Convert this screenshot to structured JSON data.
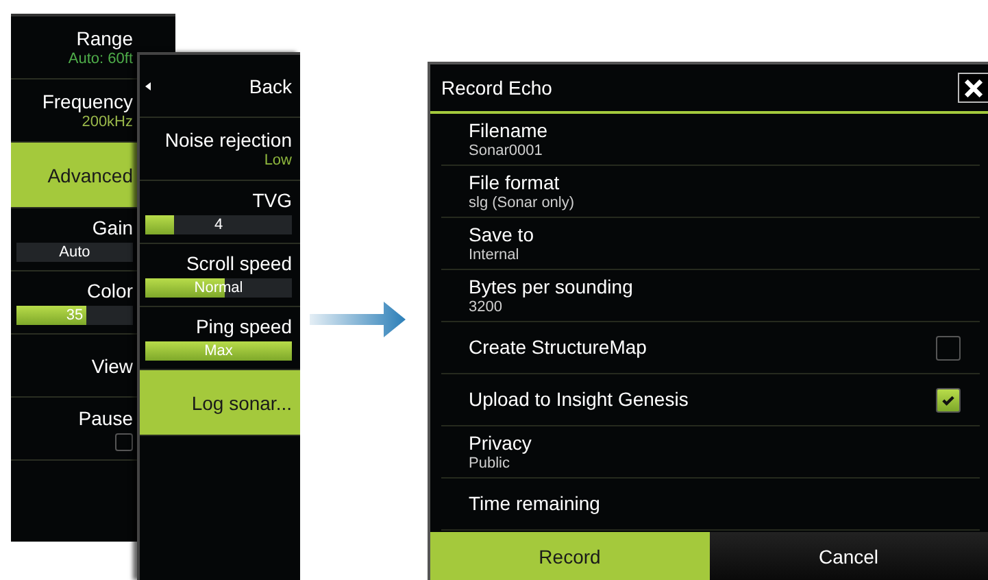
{
  "back_menu": {
    "items": [
      {
        "kind": "value",
        "label": "Range",
        "value": "Auto: 60ft",
        "color": "#4fae4a"
      },
      {
        "kind": "value",
        "label": "Frequency",
        "value": "200kHz",
        "color": "#9ab84a"
      },
      {
        "kind": "button",
        "label": "Advanced",
        "selected": true
      },
      {
        "kind": "slider",
        "label": "Gain",
        "reading": "Auto"
      },
      {
        "kind": "slider",
        "label": "Color",
        "reading": "35",
        "level": 0.6
      },
      {
        "kind": "button",
        "label": "View",
        "selected": false
      },
      {
        "kind": "checkbox",
        "label": "Pause",
        "checked": false
      }
    ]
  },
  "front_menu": {
    "items": [
      {
        "kind": "back",
        "label": "Back"
      },
      {
        "kind": "value",
        "label": "Noise rejection",
        "value": "Low",
        "color": "#8fb83e"
      },
      {
        "kind": "slider",
        "label": "TVG",
        "reading": "4",
        "level": 0.2
      },
      {
        "kind": "slider",
        "label": "Scroll speed",
        "reading": "Normal",
        "level": 0.54
      },
      {
        "kind": "slider",
        "label": "Ping speed",
        "reading": "Max",
        "level": 1
      },
      {
        "kind": "button",
        "label": "Log sonar...",
        "selected": true
      }
    ]
  },
  "dialog": {
    "title": "Record Echo",
    "rows": [
      {
        "kind": "value",
        "label": "Filename",
        "value": "Sonar0001"
      },
      {
        "kind": "value",
        "label": "File format",
        "value": "slg (Sonar only)"
      },
      {
        "kind": "value",
        "label": "Save to",
        "value": "Internal"
      },
      {
        "kind": "value",
        "label": "Bytes per sounding",
        "value": "3200"
      },
      {
        "kind": "checkbox",
        "label": "Create StructureMap",
        "checked": false
      },
      {
        "kind": "checkbox",
        "label": "Upload to Insight Genesis",
        "checked": true
      },
      {
        "kind": "value",
        "label": "Privacy",
        "value": "Public"
      },
      {
        "kind": "value",
        "label": "Time remaining"
      }
    ],
    "buttons": [
      {
        "label": "Record",
        "selected": true
      },
      {
        "label": "Cancel",
        "selected": false
      }
    ]
  }
}
